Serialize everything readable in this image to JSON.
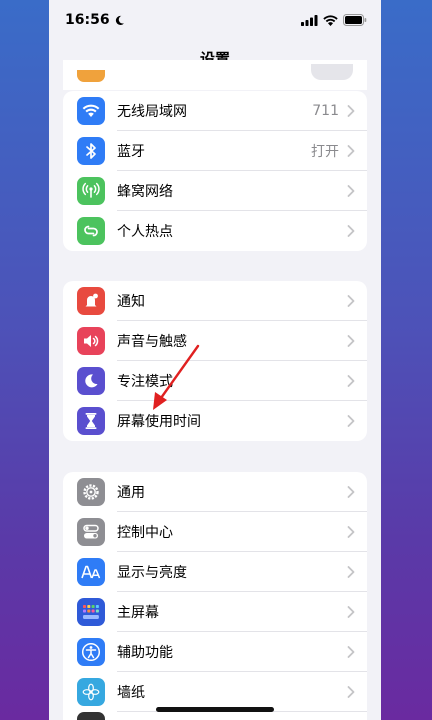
{
  "status_bar": {
    "time": "16:56"
  },
  "nav": {
    "title": "设置"
  },
  "group1": [
    {
      "label": "无线局域网",
      "value": "711",
      "icon": "wifi-icon",
      "color": "#2f7cf6"
    },
    {
      "label": "蓝牙",
      "value": "打开",
      "icon": "bluetooth-icon",
      "color": "#2f7cf6"
    },
    {
      "label": "蜂窝网络",
      "value": "",
      "icon": "antenna-icon",
      "color": "#4cc35e"
    },
    {
      "label": "个人热点",
      "value": "",
      "icon": "hotspot-icon",
      "color": "#4cc35e"
    }
  ],
  "group2": [
    {
      "label": "通知",
      "icon": "notification-icon",
      "color": "#e84a3f"
    },
    {
      "label": "声音与触感",
      "icon": "speaker-icon",
      "color": "#e8435a"
    },
    {
      "label": "专注模式",
      "icon": "moon-icon",
      "color": "#5a4fcf"
    },
    {
      "label": "屏幕使用时间",
      "icon": "hourglass-icon",
      "color": "#5a4fcf"
    }
  ],
  "group3": [
    {
      "label": "通用",
      "icon": "gear-icon",
      "color": "#8e8e93"
    },
    {
      "label": "控制中心",
      "icon": "toggles-icon",
      "color": "#8e8e93"
    },
    {
      "label": "显示与亮度",
      "icon": "display-aa-icon",
      "color": "#2f7cf6"
    },
    {
      "label": "主屏幕",
      "icon": "home-grid-icon",
      "color": "#2f5ad8"
    },
    {
      "label": "辅助功能",
      "icon": "accessibility-icon",
      "color": "#2f7cf6"
    },
    {
      "label": "墙纸",
      "icon": "wallpaper-icon",
      "color": "#36a8e0"
    }
  ]
}
